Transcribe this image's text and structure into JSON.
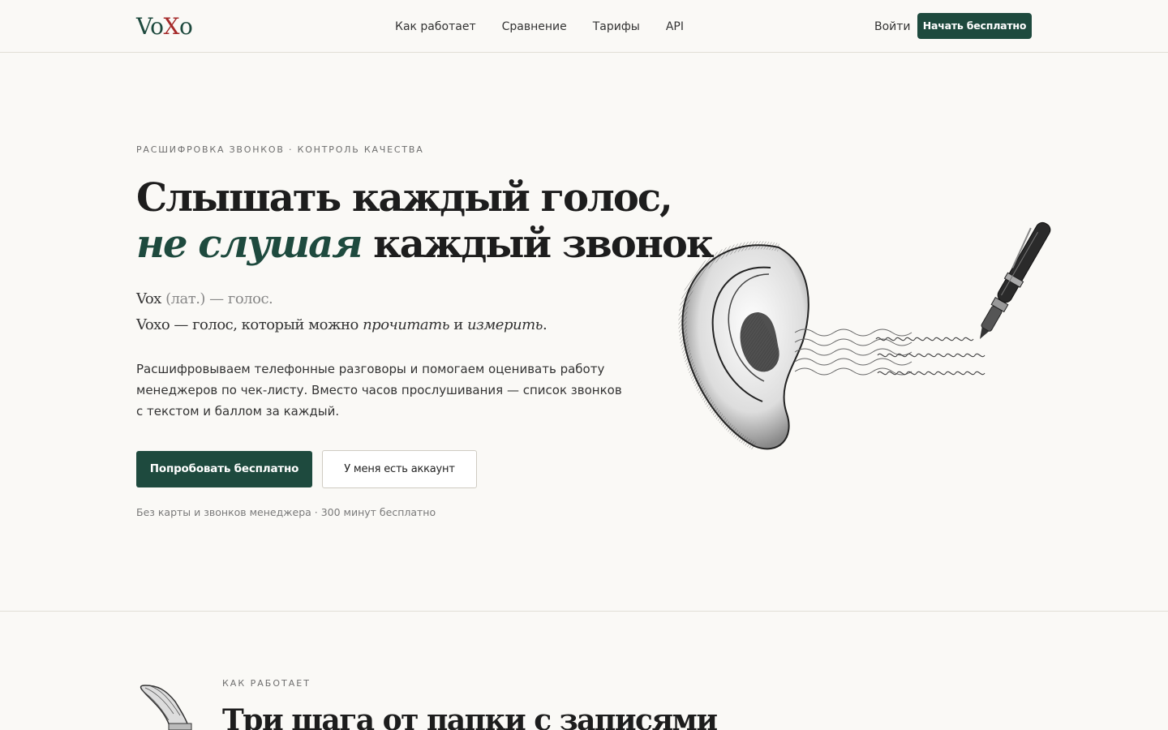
{
  "brand": {
    "logo_v": "Vo",
    "logo_x": "X",
    "logo_o": "o"
  },
  "nav": {
    "items": [
      {
        "label": "Как работает"
      },
      {
        "label": "Сравнение"
      },
      {
        "label": "Тарифы"
      },
      {
        "label": "API"
      }
    ],
    "login": "Войти",
    "cta": "Начать бесплатно"
  },
  "hero": {
    "eyebrow": "РАСШИФРОВКА ЗВОНКОВ · КОНТРОЛЬ КАЧЕСТВА",
    "title_line1": "Слышать каждый голос,",
    "title_em": "не слушая",
    "title_rest": " каждый звонок",
    "tag1_main": "Vox",
    "tag1_muted": " (лат.) — голос.",
    "tag2_a": "Voxo — голос, который можно ",
    "tag2_i1": "прочитать",
    "tag2_b": " и ",
    "tag2_i2": "измерить",
    "tag2_c": ".",
    "description": "Расшифровываем телефонные разговоры и помогаем оценивать работу менеджеров по чек-листу. Вместо часов прослушивания — список звонков с текстом и баллом за каждый.",
    "primary_button": "Попробовать бесплатно",
    "secondary_button": "У меня есть аккаунт",
    "fine_print": "Без карты и звонков менеджера · 300 минут бесплатно"
  },
  "how_it_works": {
    "eyebrow": "КАК РАБОТАЕТ",
    "title": "Три шага от папки с записями"
  },
  "colors": {
    "accent": "#1e4a3e",
    "logo_x": "#a52a2a",
    "background": "#faf9f6"
  },
  "icons": {
    "hero": "ear-pen-illustration-icon",
    "section": "gramophone-icon"
  }
}
